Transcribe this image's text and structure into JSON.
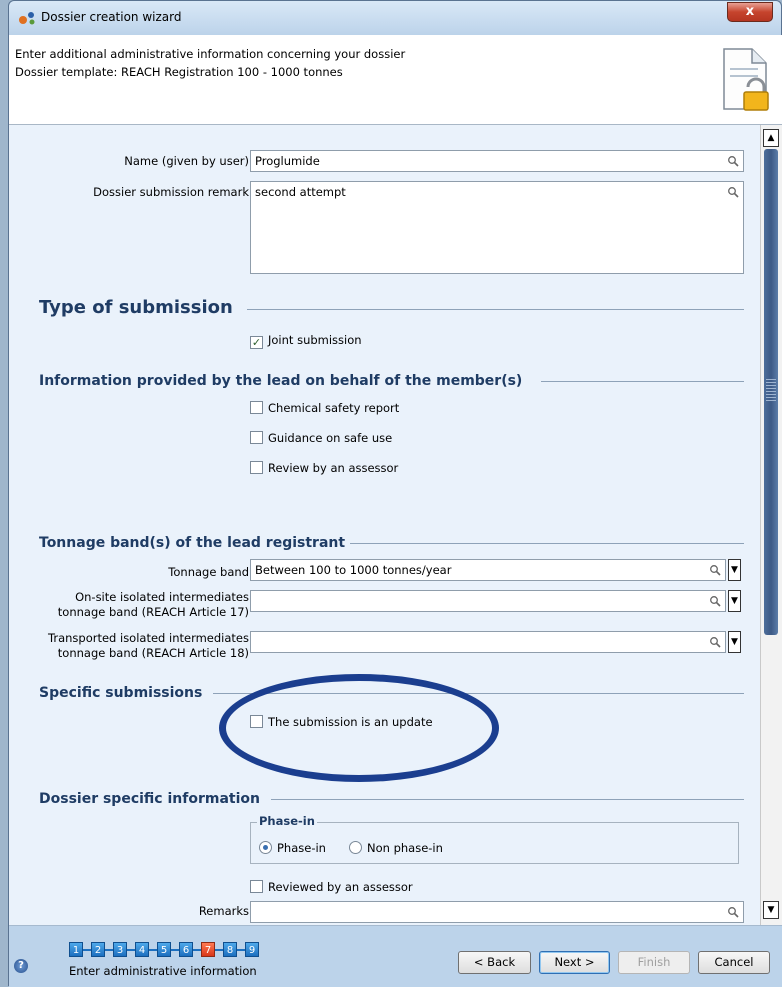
{
  "window": {
    "title": "Dossier creation wizard",
    "close_glyph": "x"
  },
  "header": {
    "line1": "Enter additional administrative information concerning your dossier",
    "line2": "Dossier template: REACH Registration 100 - 1000 tonnes",
    "icon": "document-lock-icon"
  },
  "form": {
    "name_label": "Name (given by user)",
    "name_value": "Proglumide",
    "remark_label": "Dossier submission remark",
    "remark_value": "second attempt"
  },
  "type_of_submission": {
    "title": "Type of submission",
    "joint_submission": {
      "label": "Joint submission",
      "checked": true
    }
  },
  "lead_info": {
    "title": "Information provided by the lead on behalf of the member(s)",
    "items": [
      {
        "label": "Chemical safety report",
        "checked": false
      },
      {
        "label": "Guidance on safe use",
        "checked": false
      },
      {
        "label": "Review by an assessor",
        "checked": false
      }
    ]
  },
  "tonnage": {
    "title": "Tonnage band(s) of the lead registrant",
    "band_label": "Tonnage band",
    "band_value": "Between 100 to 1000 tonnes/year",
    "onsite_label_1": "On-site isolated intermediates",
    "onsite_label_2": "tonnage band (REACH Article 17)",
    "onsite_value": "",
    "transported_label_1": "Transported isolated intermediates",
    "transported_label_2": "tonnage band (REACH Article 18)",
    "transported_value": ""
  },
  "specific": {
    "title": "Specific submissions",
    "update": {
      "label": "The submission is an update",
      "checked": false
    }
  },
  "dossier_specific": {
    "title": "Dossier specific information",
    "phase_group_title": "Phase-in",
    "phase_in_label": "Phase-in",
    "non_phase_in_label": "Non phase-in",
    "selected": "Phase-in",
    "reviewed_label": "Reviewed by an assessor",
    "reviewed_checked": false,
    "remarks_label": "Remarks",
    "remarks_value": ""
  },
  "wizard": {
    "steps": [
      "1",
      "2",
      "3",
      "4",
      "5",
      "6",
      "7",
      "8",
      "9"
    ],
    "current_step": "7",
    "caption": "Enter administrative information",
    "buttons": {
      "back": "< Back",
      "next": "Next >",
      "finish": "Finish",
      "cancel": "Cancel"
    }
  },
  "colors": {
    "accent": "#1b3e8f",
    "section_title": "#1f3c64",
    "current_step": "#d8361a",
    "step": "#1c6fbf"
  },
  "icons": [
    "app-icon",
    "close-icon",
    "document-lock-icon",
    "magnifier-icon",
    "chevron-down-icon",
    "chevron-up-icon",
    "help-icon",
    "checkmark-icon"
  ]
}
